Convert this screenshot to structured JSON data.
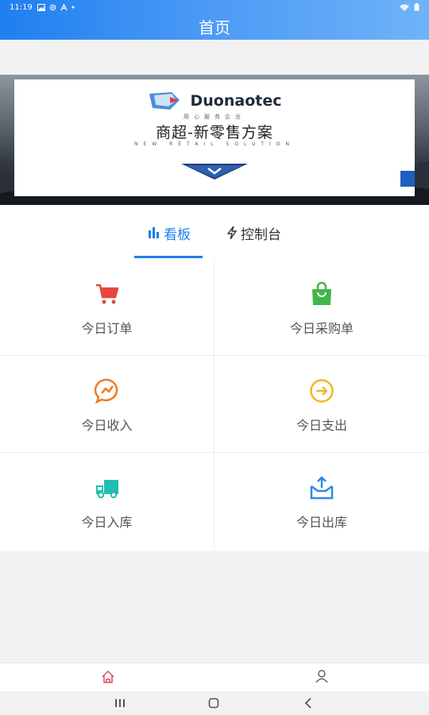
{
  "status_bar": {
    "time": "11:19"
  },
  "header": {
    "title": "首页"
  },
  "banner": {
    "brand": "Duonaotec",
    "brand_sub": "用心服务企业",
    "tagline": "商超-新零售方案",
    "tagline_en": "NEW RETAIL SOLUTION"
  },
  "tabs": [
    {
      "label": "看板",
      "icon": "bar-chart-icon",
      "active": true
    },
    {
      "label": "控制台",
      "icon": "lightning-icon",
      "active": false
    }
  ],
  "tiles": [
    {
      "label": "今日订单",
      "icon": "shopping-cart-icon",
      "color": "#e8463c"
    },
    {
      "label": "今日采购单",
      "icon": "shopping-bag-icon",
      "color": "#3fb54a"
    },
    {
      "label": "今日收入",
      "icon": "income-chat-icon",
      "color": "#f07a22"
    },
    {
      "label": "今日支出",
      "icon": "arrow-circle-icon",
      "color": "#f0b81e"
    },
    {
      "label": "今日入库",
      "icon": "truck-icon",
      "color": "#20c0b0"
    },
    {
      "label": "今日出库",
      "icon": "outbox-icon",
      "color": "#2b8be8"
    }
  ],
  "bottom_nav": [
    {
      "icon": "home-icon",
      "active": true,
      "color": "#e04b5a"
    },
    {
      "icon": "user-icon",
      "active": false,
      "color": "#666666"
    }
  ],
  "colors": {
    "accent": "#1f7ff0"
  }
}
